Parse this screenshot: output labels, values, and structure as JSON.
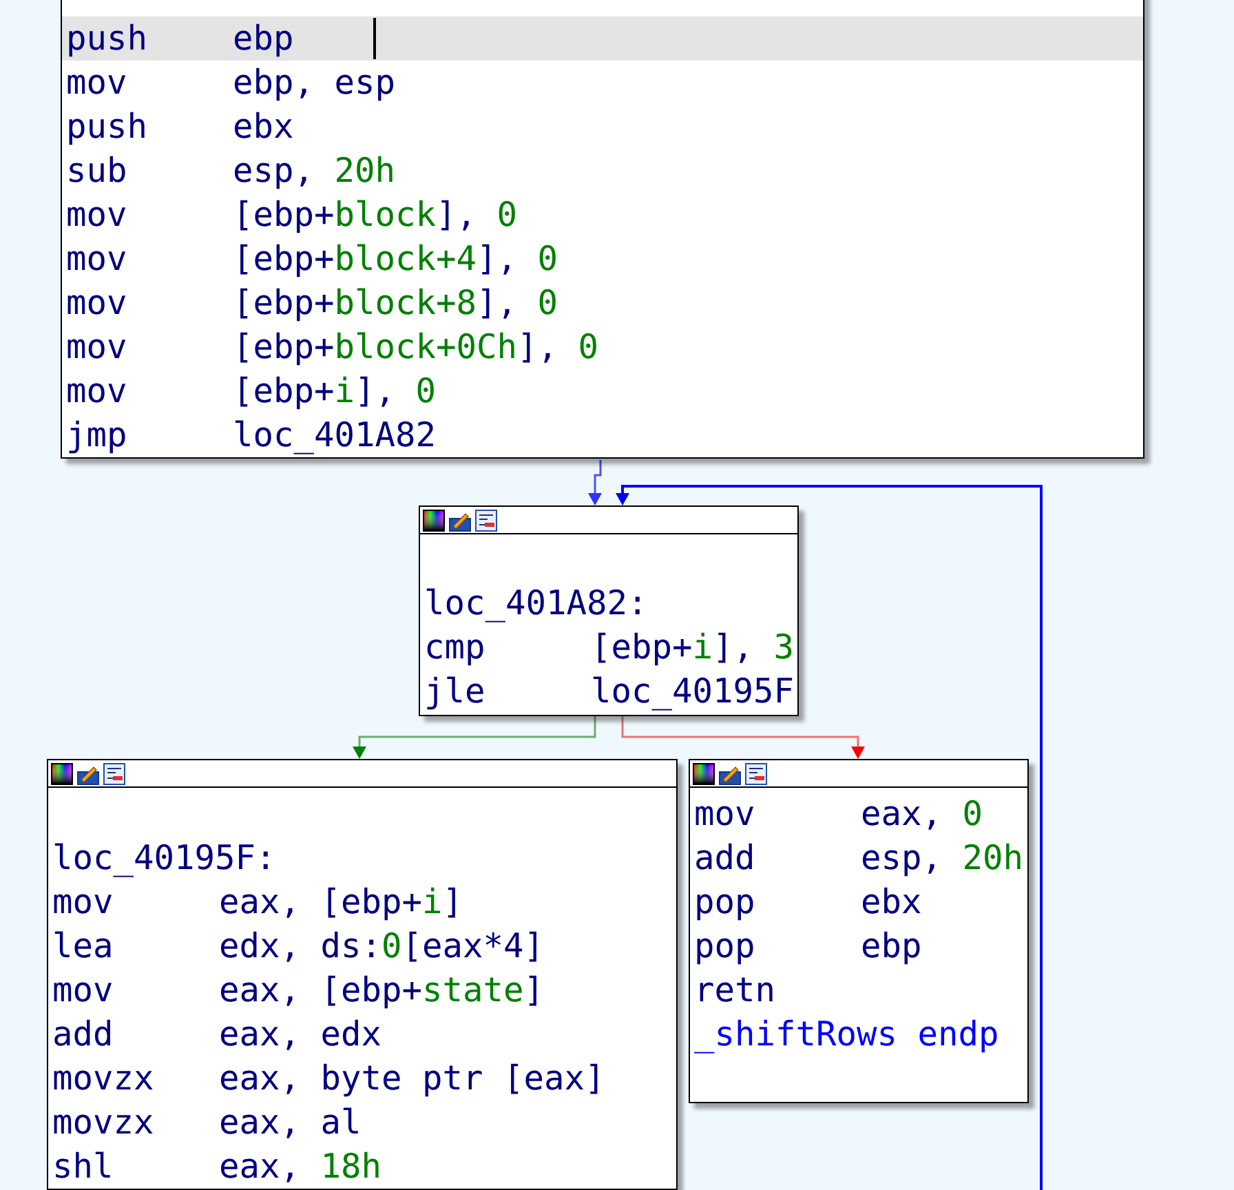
{
  "blocks": [
    {
      "toolbar": false,
      "lines": [
        {
          "kind": "ins",
          "selected": true,
          "op": "push",
          "args": [
            {
              "t": "ebp",
              "kind": "plain"
            }
          ]
        },
        {
          "kind": "ins",
          "selected": false,
          "op": "mov",
          "args": [
            {
              "t": "ebp, esp",
              "kind": "plain"
            }
          ]
        },
        {
          "kind": "ins",
          "selected": false,
          "op": "push",
          "args": [
            {
              "t": "ebx",
              "kind": "plain"
            }
          ]
        },
        {
          "kind": "ins",
          "selected": false,
          "op": "sub",
          "args": [
            {
              "t": "esp, ",
              "kind": "plain"
            },
            {
              "t": "20h",
              "kind": "num"
            }
          ]
        },
        {
          "kind": "ins",
          "selected": false,
          "op": "mov",
          "args": [
            {
              "t": "[ebp+",
              "kind": "plain"
            },
            {
              "t": "block",
              "kind": "name"
            },
            {
              "t": "], ",
              "kind": "plain"
            },
            {
              "t": "0",
              "kind": "num"
            }
          ]
        },
        {
          "kind": "ins",
          "selected": false,
          "op": "mov",
          "args": [
            {
              "t": "[ebp+",
              "kind": "plain"
            },
            {
              "t": "block+4",
              "kind": "name"
            },
            {
              "t": "], ",
              "kind": "plain"
            },
            {
              "t": "0",
              "kind": "num"
            }
          ]
        },
        {
          "kind": "ins",
          "selected": false,
          "op": "mov",
          "args": [
            {
              "t": "[ebp+",
              "kind": "plain"
            },
            {
              "t": "block+8",
              "kind": "name"
            },
            {
              "t": "], ",
              "kind": "plain"
            },
            {
              "t": "0",
              "kind": "num"
            }
          ]
        },
        {
          "kind": "ins",
          "selected": false,
          "op": "mov",
          "args": [
            {
              "t": "[ebp+",
              "kind": "plain"
            },
            {
              "t": "block+0Ch",
              "kind": "name"
            },
            {
              "t": "], ",
              "kind": "plain"
            },
            {
              "t": "0",
              "kind": "num"
            }
          ]
        },
        {
          "kind": "ins",
          "selected": false,
          "op": "mov",
          "args": [
            {
              "t": "[ebp+",
              "kind": "plain"
            },
            {
              "t": "i",
              "kind": "name"
            },
            {
              "t": "], ",
              "kind": "plain"
            },
            {
              "t": "0",
              "kind": "num"
            }
          ]
        },
        {
          "kind": "ins",
          "selected": false,
          "op": "jmp",
          "args": [
            {
              "t": "loc_401A82",
              "kind": "plain"
            }
          ]
        }
      ]
    },
    {
      "toolbar": true,
      "lines": [
        {
          "kind": "label",
          "text": "loc_401A82:"
        },
        {
          "kind": "ins",
          "selected": false,
          "op": "cmp",
          "args": [
            {
              "t": "[ebp+",
              "kind": "plain"
            },
            {
              "t": "i",
              "kind": "name"
            },
            {
              "t": "], ",
              "kind": "plain"
            },
            {
              "t": "3",
              "kind": "num"
            }
          ]
        },
        {
          "kind": "ins",
          "selected": false,
          "op": "jle",
          "args": [
            {
              "t": "loc_40195F",
              "kind": "plain"
            }
          ]
        }
      ]
    },
    {
      "toolbar": true,
      "lines": [
        {
          "kind": "label",
          "text": "loc_40195F:"
        },
        {
          "kind": "ins",
          "selected": false,
          "op": "mov",
          "args": [
            {
              "t": "eax, [ebp+",
              "kind": "plain"
            },
            {
              "t": "i",
              "kind": "name"
            },
            {
              "t": "]",
              "kind": "plain"
            }
          ]
        },
        {
          "kind": "ins",
          "selected": false,
          "op": "lea",
          "args": [
            {
              "t": "edx, ds:",
              "kind": "plain"
            },
            {
              "t": "0",
              "kind": "num"
            },
            {
              "t": "[eax*4]",
              "kind": "plain"
            }
          ]
        },
        {
          "kind": "ins",
          "selected": false,
          "op": "mov",
          "args": [
            {
              "t": "eax, [ebp+",
              "kind": "plain"
            },
            {
              "t": "state",
              "kind": "name"
            },
            {
              "t": "]",
              "kind": "plain"
            }
          ]
        },
        {
          "kind": "ins",
          "selected": false,
          "op": "add",
          "args": [
            {
              "t": "eax, edx",
              "kind": "plain"
            }
          ]
        },
        {
          "kind": "ins",
          "selected": false,
          "op": "movzx",
          "args": [
            {
              "t": "eax, byte ptr [eax]",
              "kind": "plain"
            }
          ]
        },
        {
          "kind": "ins",
          "selected": false,
          "op": "movzx",
          "args": [
            {
              "t": "eax, al",
              "kind": "plain"
            }
          ]
        },
        {
          "kind": "ins",
          "selected": false,
          "op": "shl",
          "args": [
            {
              "t": "eax, ",
              "kind": "plain"
            },
            {
              "t": "18h",
              "kind": "num"
            }
          ]
        }
      ]
    },
    {
      "toolbar": true,
      "lines": [
        {
          "kind": "ins",
          "selected": false,
          "op": "mov",
          "args": [
            {
              "t": "eax, ",
              "kind": "plain"
            },
            {
              "t": "0",
              "kind": "num"
            }
          ]
        },
        {
          "kind": "ins",
          "selected": false,
          "op": "add",
          "args": [
            {
              "t": "esp, ",
              "kind": "plain"
            },
            {
              "t": "20h",
              "kind": "num"
            }
          ]
        },
        {
          "kind": "ins",
          "selected": false,
          "op": "pop",
          "args": [
            {
              "t": "ebx",
              "kind": "plain"
            }
          ]
        },
        {
          "kind": "ins",
          "selected": false,
          "op": "pop",
          "args": [
            {
              "t": "ebp",
              "kind": "plain"
            }
          ]
        },
        {
          "kind": "ins",
          "selected": false,
          "op": "retn"
        },
        {
          "kind": "endp",
          "text": "_shiftRows endp"
        }
      ]
    }
  ]
}
